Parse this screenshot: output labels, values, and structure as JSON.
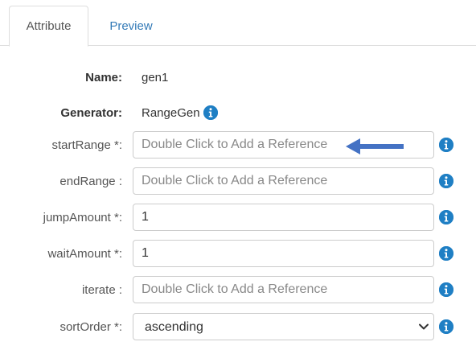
{
  "tabs": [
    {
      "label": "Attribute",
      "active": true
    },
    {
      "label": "Preview",
      "active": false
    }
  ],
  "form": {
    "name": {
      "label": "Name:",
      "value": "gen1"
    },
    "generator": {
      "label": "Generator:",
      "value": "RangeGen"
    },
    "startRange": {
      "label": "startRange *:",
      "value": "",
      "placeholder": "Double Click to Add a Reference"
    },
    "endRange": {
      "label": "endRange :",
      "value": "",
      "placeholder": "Double Click to Add a Reference"
    },
    "jumpAmount": {
      "label": "jumpAmount *:",
      "value": "1"
    },
    "waitAmount": {
      "label": "waitAmount *:",
      "value": "1"
    },
    "iterate": {
      "label": "iterate :",
      "value": "",
      "placeholder": "Double Click to Add a Reference"
    },
    "sortOrder": {
      "label": "sortOrder *:",
      "value": "ascending",
      "options": [
        "ascending"
      ]
    }
  },
  "icons": {
    "info": "info-icon",
    "arrow": "arrow-left-icon",
    "chevron": "chevron-down-icon"
  },
  "colors": {
    "accent": "#337ab7",
    "info_icon": "#1f7fc4",
    "annotation_arrow": "#4472c4"
  }
}
